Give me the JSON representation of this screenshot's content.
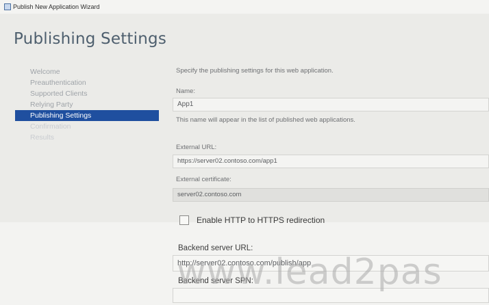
{
  "window": {
    "title": "Publish New Application Wizard"
  },
  "page": {
    "title": "Publishing Settings"
  },
  "nav": {
    "items": [
      {
        "label": "Welcome"
      },
      {
        "label": "Preauthentication"
      },
      {
        "label": "Supported Clients"
      },
      {
        "label": "Relying Party"
      },
      {
        "label": "Publishing Settings"
      },
      {
        "label": "Confirmation"
      },
      {
        "label": "Results"
      }
    ]
  },
  "main": {
    "intro": "Specify the publishing settings for this web application.",
    "name_label": "Name:",
    "name_value": "App1",
    "name_help": "This name will appear in the list of published web applications.",
    "external_url_label": "External URL:",
    "external_url_value": "https://server02.contoso.com/app1",
    "external_cert_label": "External certificate:",
    "external_cert_value": "server02.contoso.com",
    "redirect_label": "Enable HTTP to HTTPS redirection",
    "redirect_checked": false,
    "backend_url_label": "Backend server URL:",
    "backend_url_value": "http://server02.contoso.com/publish/app",
    "backend_spn_label": "Backend server SPN:"
  },
  "watermark": {
    "text": "www.lead2pas"
  }
}
